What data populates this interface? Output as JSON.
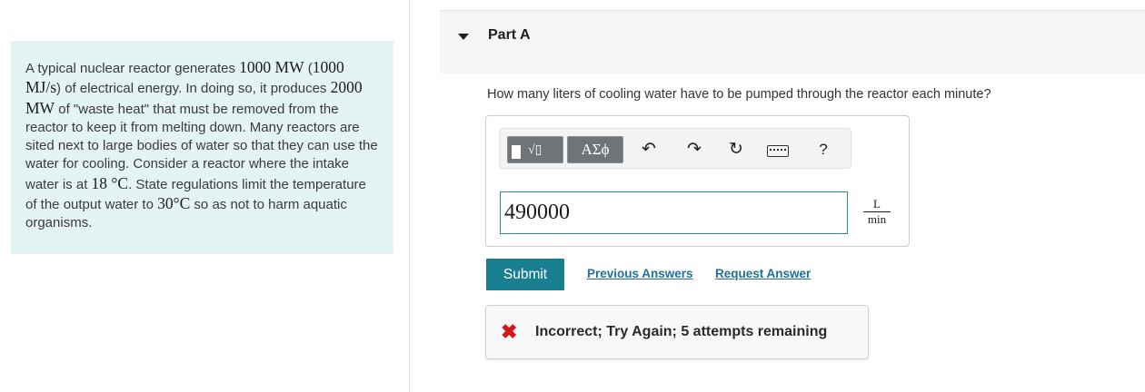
{
  "problem": {
    "t1": "A typical nuclear reactor generates ",
    "m1": "1000 MW",
    "t2": " (",
    "m2": "1000 MJ/s",
    "t3": ") of electrical energy. In doing so, it produces ",
    "m3": "2000 MW",
    "t4": " of \"waste heat\" that must be removed from the reactor to keep it from melting down. Many reactors are sited next to large bodies of water so that they can use the water for cooling. Consider a reactor where the intake water is at ",
    "m4": "18 °C",
    "t5": ". State regulations limit the temperature of the output water to ",
    "m5": "30°C",
    "t6": " so as not to harm aquatic organisms."
  },
  "part": {
    "title": "Part A"
  },
  "question": "How many liters of cooling water have to be pumped through the reactor each minute?",
  "toolbar": {
    "templates_glyph": "√▯",
    "symbols_label": "ΑΣϕ",
    "undo_glyph": "↶",
    "redo_glyph": "↷",
    "reset_glyph": "↻",
    "help_glyph": "?"
  },
  "answer": {
    "value": "490000",
    "unit_num": "L",
    "unit_den": "min"
  },
  "actions": {
    "submit": "Submit",
    "previous": "Previous Answers",
    "request": "Request Answer"
  },
  "feedback": {
    "icon": "✖",
    "text": "Incorrect; Try Again; 5 attempts remaining",
    "color": "#d2161a"
  }
}
